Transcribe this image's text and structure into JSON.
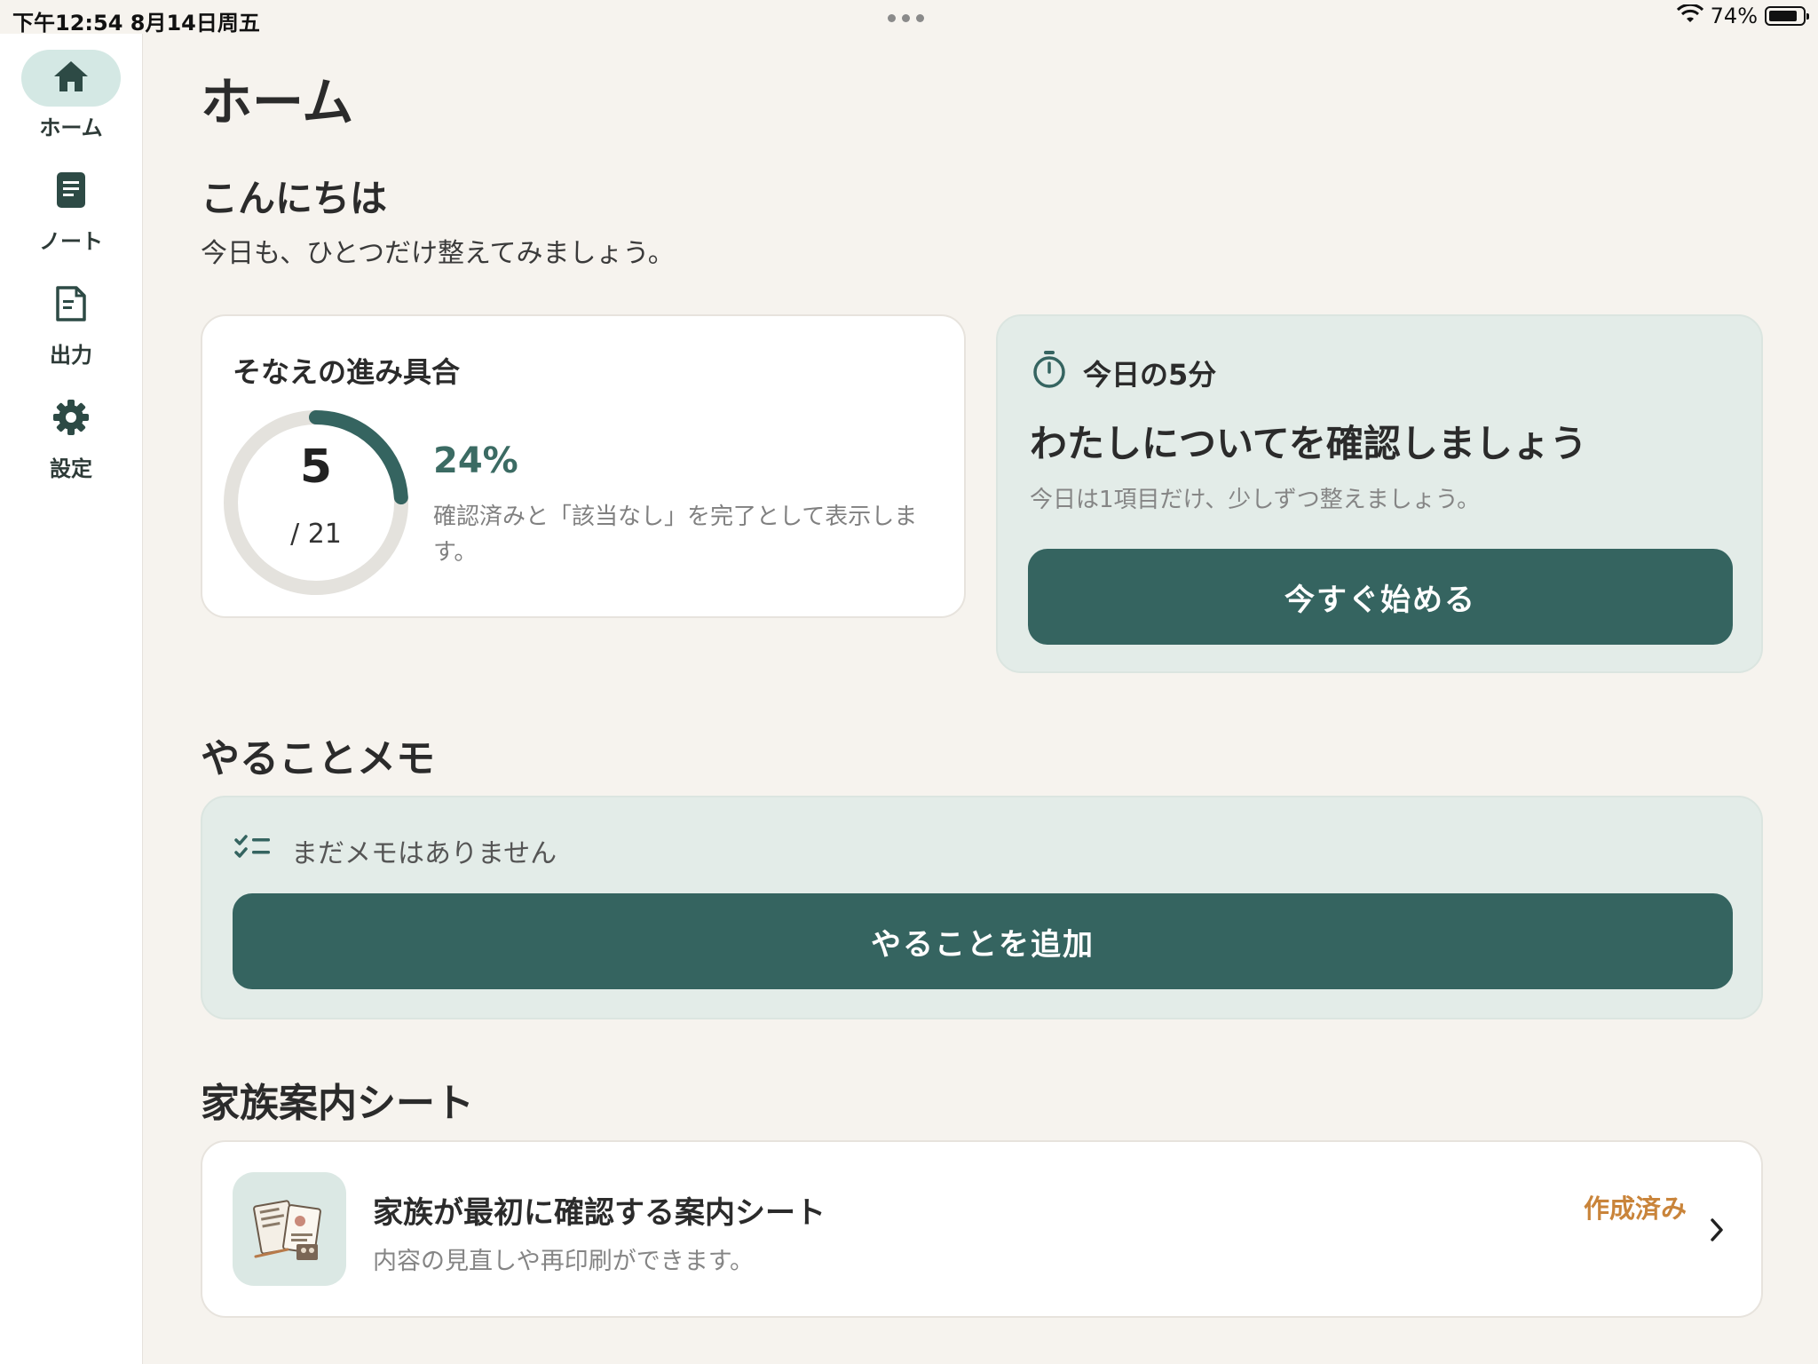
{
  "status_bar": {
    "time_date": "下午12:54   8月14日周五",
    "battery_pct": "74%",
    "battery_level": 0.74
  },
  "sidebar": {
    "items": [
      {
        "label": "ホーム",
        "icon": "home-icon",
        "active": true
      },
      {
        "label": "ノート",
        "icon": "note-icon",
        "active": false
      },
      {
        "label": "出力",
        "icon": "document-icon",
        "active": false
      },
      {
        "label": "設定",
        "icon": "gear-icon",
        "active": false
      }
    ]
  },
  "page": {
    "title": "ホーム",
    "greeting": "こんにちは",
    "greeting_sub": "今日も、ひとつだけ整えてみましょう。"
  },
  "progress_card": {
    "title": "そなえの進み具合",
    "done": "5",
    "total_label": "/ 21",
    "percent_label": "24%",
    "percent_value": 0.24,
    "note": "確認済みと「該当なし」を完了として表示します。"
  },
  "today_card": {
    "heading": "今日の5分",
    "title": "わたしについてを確認しましょう",
    "subtitle": "今日は1項目だけ、少しずつ整えましょう。",
    "button": "今すぐ始める"
  },
  "memo": {
    "heading": "やることメモ",
    "empty_text": "まだメモはありません",
    "button": "やることを追加"
  },
  "family_sheet": {
    "heading": "家族案内シート",
    "title": "家族が最初に確認する案内シート",
    "subtitle": "内容の見直しや再印刷ができます。",
    "status": "作成済み"
  },
  "colors": {
    "accent": "#356460",
    "ring_track": "#e4e2dd",
    "status_orange": "#c9843a",
    "mint_bg": "#e3ece8",
    "page_bg": "#f6f3ee"
  }
}
